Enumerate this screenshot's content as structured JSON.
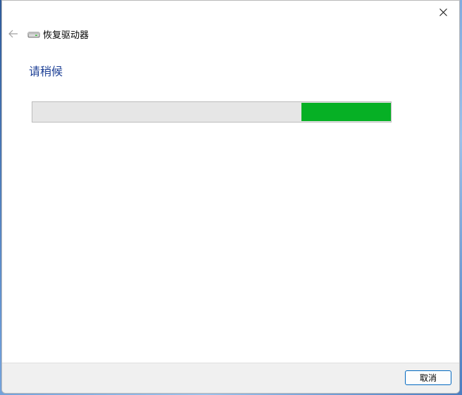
{
  "window": {
    "title": "恢复驱动器",
    "close_icon": "close-icon",
    "back_icon": "back-arrow-icon",
    "drive_icon": "drive-icon"
  },
  "main": {
    "heading": "请稍候"
  },
  "progress": {
    "style": "marquee",
    "chunk_start_fraction": 0.75,
    "chunk_end_fraction": 1.0,
    "track_color": "#e6e6e6",
    "fill_color": "#06b025"
  },
  "footer": {
    "cancel_label": "取消"
  },
  "colors": {
    "heading": "#1c3f95",
    "button_border": "#0067c0",
    "footer_bg": "#f0f0f0"
  }
}
